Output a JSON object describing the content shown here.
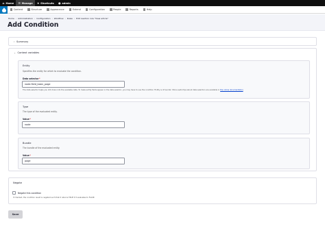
{
  "toolbar": {
    "home": "Home",
    "manage": "Manage",
    "shortcuts": "Shortcuts",
    "user": "admin"
  },
  "tray": {
    "items": [
      "Content",
      "Structure",
      "Appearance",
      "Extend",
      "Configuration",
      "People",
      "Reports",
      "Help"
    ]
  },
  "breadcrumb": [
    "Home",
    "Administration",
    "Configuration",
    "Workflow",
    "Rules",
    "Edit reaction rule \"View article\""
  ],
  "page": {
    "title": "Add Condition"
  },
  "summary": {
    "label": "Summary"
  },
  "context": {
    "label": "Context variables",
    "entity": {
      "legend": "Entity",
      "description": "Specifies the entity for which to evaluate the condition.",
      "field_label": "Data selector",
      "value": "node.field_basic_page",
      "help": "The data selector helps you drill down into the available data. To make entity fields appear in the data selector, you may have to use the condition 'Entity is of bundle'. More useful tips about data selection are available in",
      "help_link": "the online documentation",
      "help_end": "."
    },
    "type": {
      "legend": "Type",
      "description": "The type of the evaluated entity.",
      "field_label": "Value",
      "value": "node"
    },
    "bundle": {
      "legend": "Bundle",
      "description": "The bundle of the evaluated entity.",
      "field_label": "Value",
      "value": "page"
    }
  },
  "negate": {
    "legend": "Negate",
    "checkbox_label": "Negate this condition",
    "description": "If checked, the condition result is negated such that it returns TRUE if it evaluates to FALSE."
  },
  "actions": {
    "save": "Save"
  },
  "colors": {
    "toolbar": "#0f0f0f",
    "logo": "#0678be",
    "required": "#dc2323",
    "link": "#003ecc"
  }
}
